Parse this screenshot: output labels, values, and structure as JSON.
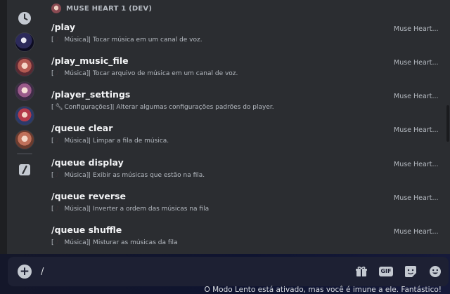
{
  "bot_header": {
    "title": "MUSE HEART 1 (DEV)"
  },
  "commands": [
    {
      "name": "/play",
      "category_open": "[",
      "category": "Música]",
      "description": " | Tocar música em um canal de voz.",
      "source": "Muse Heart..."
    },
    {
      "name": "/play_music_file",
      "category_open": "[",
      "category": "Música]",
      "description": " | Tocar arquivo de música em um canal de voz.",
      "source": "Muse Heart..."
    },
    {
      "name": "/player_settings",
      "category_open": "[",
      "category": "Configurações]",
      "description": " | Alterar algumas configurações padrões do player.",
      "source": "Muse Heart..."
    },
    {
      "name": "/queue clear",
      "category_open": "[",
      "category": "Música]",
      "description": " | Limpar a fila de música.",
      "source": "Muse Heart..."
    },
    {
      "name": "/queue display",
      "category_open": "[",
      "category": "Música]",
      "description": " | Exibir as músicas que estão na fila.",
      "source": "Muse Heart..."
    },
    {
      "name": "/queue reverse",
      "category_open": "[",
      "category": "Música]",
      "description": " | Inverter a ordem das músicas na fila",
      "source": "Muse Heart..."
    },
    {
      "name": "/queue shuffle",
      "category_open": "[",
      "category": "Música]",
      "description": " | Misturar as músicas da fila",
      "source": "Muse Heart..."
    }
  ],
  "input": {
    "value": "/"
  },
  "toolbar": {
    "gif_label": "GIF"
  },
  "footer": {
    "slowmode_text": "O Modo Lento está ativado, mas você é imune a ele. Fantástico!"
  },
  "icons": {
    "recent": "clock-icon",
    "builtin": "slash-icon",
    "gift": "gift-icon",
    "sticker": "sticker-icon",
    "emoji": "emoji-icon"
  }
}
